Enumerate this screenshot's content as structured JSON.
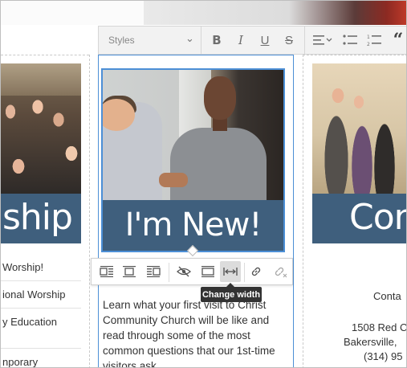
{
  "toolbar": {
    "styles_label": "Styles",
    "buttons": [
      "bold",
      "italic",
      "underline",
      "strikethrough",
      "align",
      "bulleted-list",
      "numbered-list",
      "blockquote"
    ]
  },
  "left_column": {
    "banner_text": "ship",
    "menu": [
      "Worship!",
      "ional Worship",
      "y Education",
      "nporary"
    ]
  },
  "center_column": {
    "banner_text": "I'm New!",
    "body_text": "Learn what your first visit to Christ Community Church will be like and read through some of the most common questions that our 1st-time visitors ask."
  },
  "right_column": {
    "banner_text": "Con",
    "lines": [
      "Conta",
      "1508 Red C",
      "Bakersville,",
      "(314) 95"
    ]
  },
  "image_toolbar": {
    "buttons": [
      "align-left-wrap",
      "align-center",
      "align-right-wrap",
      "hide",
      "full-width",
      "change-width",
      "link",
      "unlink"
    ],
    "active": "change-width",
    "tooltip": "Change width"
  }
}
